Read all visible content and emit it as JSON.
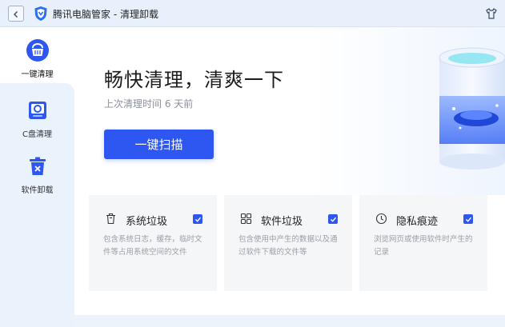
{
  "window": {
    "title": "腾讯电脑管家 - 清理卸载",
    "back_icon": "chevron-left-icon",
    "logo_icon": "tencent-shield-logo-icon",
    "skin_icon": "tshirt-icon"
  },
  "sidebar": {
    "items": [
      {
        "label": "一键清理",
        "icon": "broom-icon",
        "active": true
      },
      {
        "label": "C盘清理",
        "icon": "disk-c-icon",
        "active": false
      },
      {
        "label": "软件卸载",
        "icon": "trash-bin-icon",
        "active": false
      }
    ]
  },
  "main": {
    "headline": "畅快清理，清爽一下",
    "last_clean": "上次清理时间 6 天前",
    "scan_button": "一键扫描",
    "illustration_icon": "cleaning-device-illustration-icon"
  },
  "cards": [
    {
      "title": "系统垃圾",
      "icon": "trash-can-icon",
      "checked": true,
      "desc": "包含系统日志，缓存，临时文件等占用系统空间的文件"
    },
    {
      "title": "软件垃圾",
      "icon": "app-grid-icon",
      "checked": true,
      "desc": "包含使用中产生的数据以及通过软件下载的文件等"
    },
    {
      "title": "隐私痕迹",
      "icon": "clock-icon",
      "checked": true,
      "desc": "浏览网页或使用软件时产生的记录"
    }
  ],
  "colors": {
    "accent": "#2d57f0",
    "titlebar": "#e7f0fb",
    "sidebar_panel": "#eaf2fc",
    "card_bg": "#f5f6f8"
  }
}
